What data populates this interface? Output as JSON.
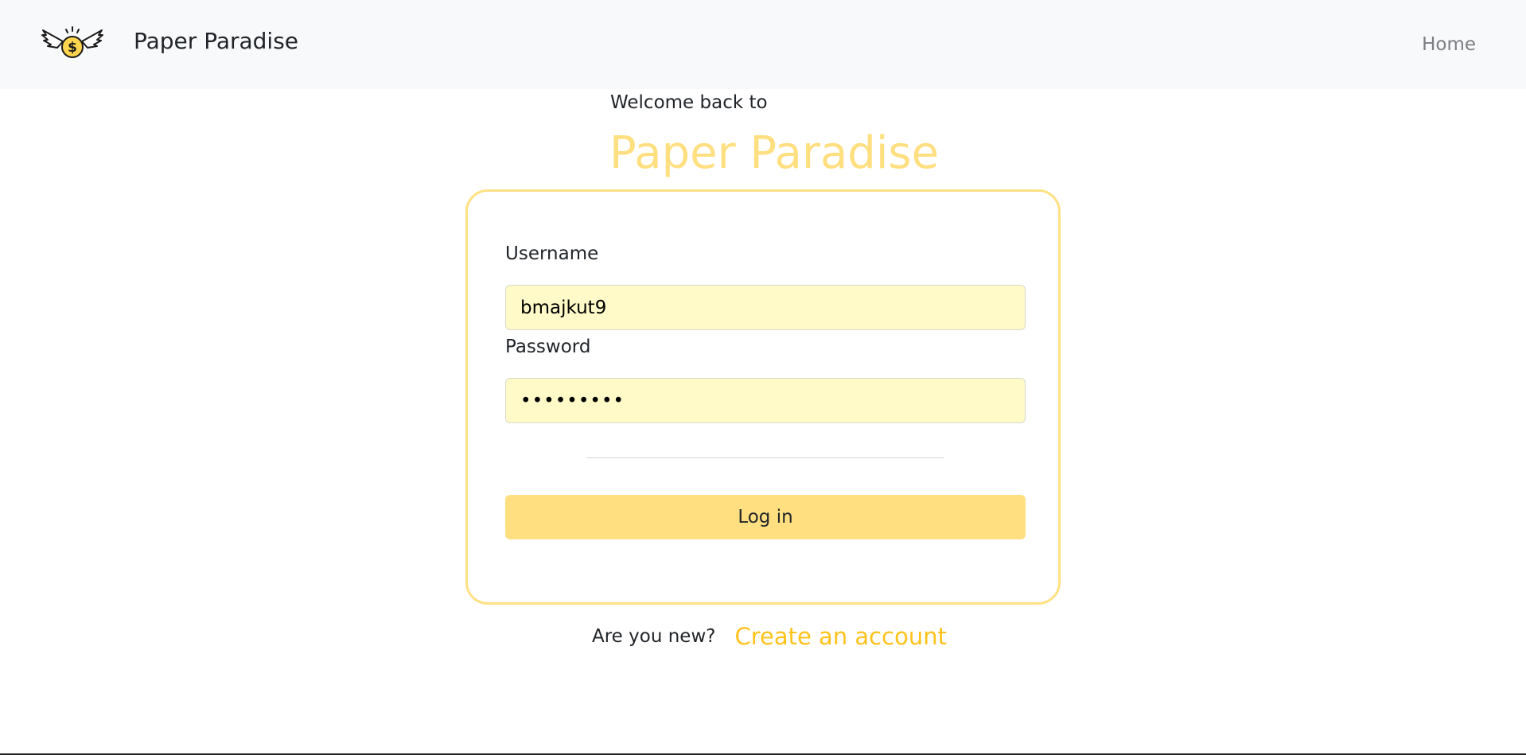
{
  "navbar": {
    "brand_name": "Paper Paradise",
    "logo_icon": "winged-dollar-coin-icon",
    "home_link": "Home"
  },
  "header": {
    "welcome_text": "Welcome back to",
    "title": "Paper Paradise"
  },
  "login_form": {
    "username_label": "Username",
    "username_value": "bmajkut9",
    "password_label": "Password",
    "password_value": "•••••••••",
    "submit_label": "Log in"
  },
  "signup": {
    "prompt": "Are you new?",
    "link_text": "Create an account"
  },
  "colors": {
    "accent": "#ffdf7f",
    "link": "#ffc21a",
    "input_background": "#fffac8",
    "navbar_background": "#f8f9fa"
  }
}
